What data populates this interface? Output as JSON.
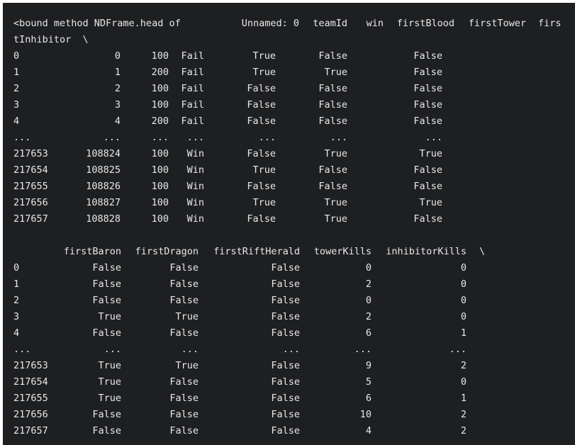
{
  "block1": {
    "header_line": {
      "bound": "<bound method NDFrame.head of",
      "columns": [
        "Unnamed: 0",
        "teamId",
        "win",
        "firstBlood",
        "firstTower",
        "firs"
      ]
    },
    "header_wrap": "tInhibitor  \\",
    "rows": [
      [
        "0",
        "0",
        "100",
        "Fail",
        "True",
        "False",
        "False"
      ],
      [
        "1",
        "1",
        "200",
        "Fail",
        "True",
        "True",
        "False"
      ],
      [
        "2",
        "2",
        "100",
        "Fail",
        "False",
        "False",
        "False"
      ],
      [
        "3",
        "3",
        "100",
        "Fail",
        "False",
        "False",
        "False"
      ],
      [
        "4",
        "4",
        "200",
        "Fail",
        "False",
        "False",
        "False"
      ],
      [
        "...",
        "...",
        "...",
        "...",
        "...",
        "...",
        "..."
      ],
      [
        "217653",
        "108824",
        "100",
        "Win",
        "False",
        "True",
        "True"
      ],
      [
        "217654",
        "108825",
        "100",
        "Win",
        "True",
        "False",
        "False"
      ],
      [
        "217655",
        "108826",
        "100",
        "Win",
        "False",
        "False",
        "False"
      ],
      [
        "217656",
        "108827",
        "100",
        "Win",
        "True",
        "True",
        "True"
      ],
      [
        "217657",
        "108828",
        "100",
        "Win",
        "False",
        "True",
        "False"
      ]
    ]
  },
  "block2": {
    "header": [
      "firstBaron",
      "firstDragon",
      "firstRiftHerald",
      "towerKills",
      "inhibitorKills",
      "\\"
    ],
    "rows": [
      [
        "0",
        "False",
        "False",
        "False",
        "0",
        "0"
      ],
      [
        "1",
        "False",
        "False",
        "False",
        "2",
        "0"
      ],
      [
        "2",
        "False",
        "False",
        "False",
        "0",
        "0"
      ],
      [
        "3",
        "True",
        "True",
        "False",
        "2",
        "0"
      ],
      [
        "4",
        "False",
        "False",
        "False",
        "6",
        "1"
      ],
      [
        "...",
        "...",
        "...",
        "...",
        "...",
        "..."
      ],
      [
        "217653",
        "True",
        "True",
        "False",
        "9",
        "2"
      ],
      [
        "217654",
        "True",
        "False",
        "False",
        "5",
        "0"
      ],
      [
        "217655",
        "True",
        "False",
        "False",
        "6",
        "1"
      ],
      [
        "217656",
        "False",
        "False",
        "False",
        "10",
        "2"
      ],
      [
        "217657",
        "False",
        "False",
        "False",
        "4",
        "2"
      ]
    ]
  }
}
